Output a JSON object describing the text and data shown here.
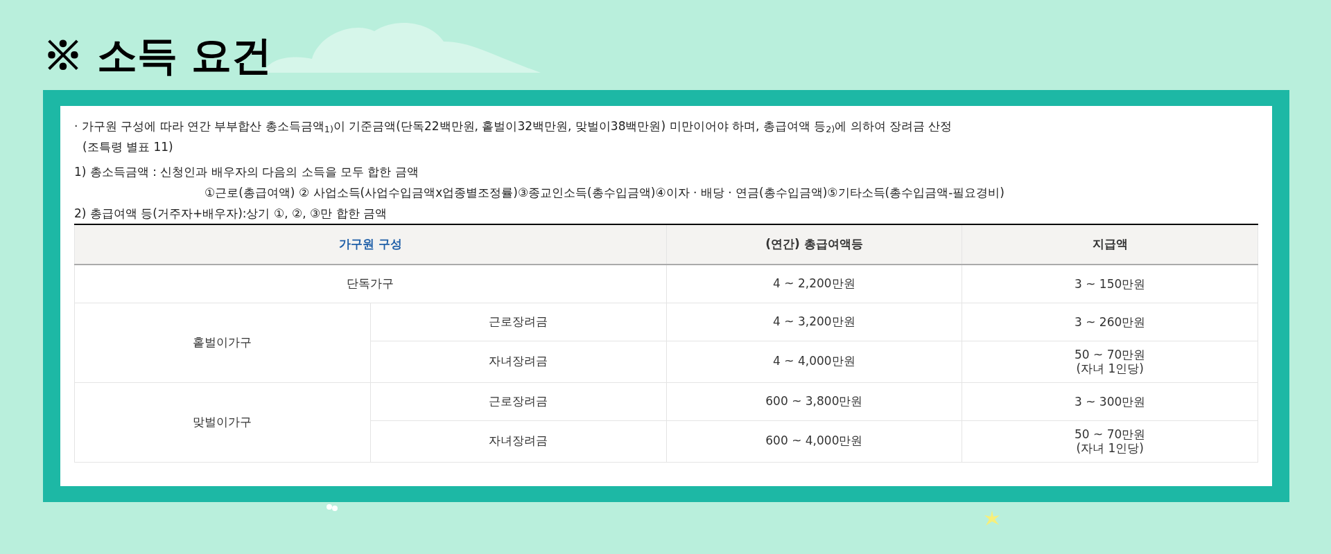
{
  "title": "※ 소득 요건",
  "notes": {
    "intro": "· 가구원 구성에 따라 연간 부부합산 총소득금액$_{1)}$이 기준금액(단독22백만원, 홑벌이32백만원, 맞벌이38백만원) 미만이어야 하며, 총급여액 등$_{2)}$에 의하여 장려금 산정",
    "intro_source": "(조특령 별표 11)",
    "footnote_1": "1) 총소득금액 : 신청인과 배우자의 다음의 소득을 모두 합한 금액",
    "footnote_1_detail": "①근로(총급여액) ② 사업소득(사업수입금액x업종별조정률)③종교인소득(총수입금액)④이자 · 배당 · 연금(총수입금액)⑤기타소득(총수입금액-필요경비)",
    "footnote_2": "2) 총급여액 등(거주자+배우자):상기 ①, ②, ③만 합한 금액"
  },
  "table": {
    "columns": [
      "가구원 구성",
      "(연간) 총급여액등",
      "지급액"
    ],
    "rows": [
      {
        "group": "단독가구",
        "items": [
          {
            "amount_range": "4 ~ 2,200만원",
            "payment": [
              "3 ~ 150만원"
            ]
          }
        ]
      },
      {
        "group": "홑벌이가구",
        "items": [
          {
            "type": "근로장려금",
            "amount_range": "4 ~ 3,200만원",
            "payment": [
              "3 ~ 260만원"
            ]
          },
          {
            "type": "자녀장려금",
            "amount_range": "4 ~ 4,000만원",
            "payment": [
              "50 ~ 70만원",
              "(자녀 1인당)"
            ]
          }
        ]
      },
      {
        "group": "맞벌이가구",
        "items": [
          {
            "type": "근로장려금",
            "amount_range": "600 ~ 3,800만원",
            "payment": [
              "3 ~ 300만원"
            ]
          },
          {
            "type": "자녀장려금",
            "amount_range": "600 ~ 4,000만원",
            "payment": [
              "50 ~ 70만원",
              "(자녀 1인당)"
            ]
          }
        ]
      }
    ]
  }
}
